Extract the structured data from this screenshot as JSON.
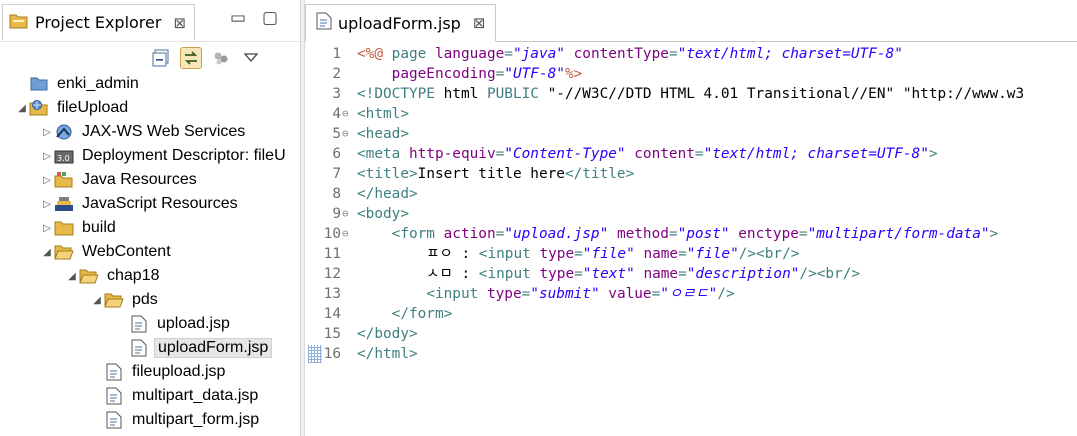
{
  "explorer": {
    "tab_label": "Project Explorer",
    "tree": [
      {
        "label": "enki_admin",
        "icon": "folder-closed-project-icon",
        "twisty": "",
        "depth": 0
      },
      {
        "label": "fileUpload",
        "icon": "web-project-icon",
        "twisty": "expanded",
        "depth": 0
      },
      {
        "label": "JAX-WS Web Services",
        "icon": "web-services-icon",
        "twisty": "collapsed",
        "depth": 1
      },
      {
        "label": "Deployment Descriptor: fileU",
        "icon": "deployment-descriptor-icon",
        "twisty": "collapsed",
        "depth": 1
      },
      {
        "label": "Java Resources",
        "icon": "java-resources-icon",
        "twisty": "collapsed",
        "depth": 1
      },
      {
        "label": "JavaScript Resources",
        "icon": "javascript-resources-icon",
        "twisty": "collapsed",
        "depth": 1
      },
      {
        "label": "build",
        "icon": "folder-icon",
        "twisty": "collapsed",
        "depth": 1
      },
      {
        "label": "WebContent",
        "icon": "folder-open-icon",
        "twisty": "expanded",
        "depth": 1
      },
      {
        "label": "chap18",
        "icon": "folder-open-icon",
        "twisty": "expanded",
        "depth": 2
      },
      {
        "label": "pds",
        "icon": "folder-open-icon",
        "twisty": "expanded",
        "depth": 3
      },
      {
        "label": "upload.jsp",
        "icon": "jsp-file-icon",
        "twisty": "",
        "depth": 4
      },
      {
        "label": "uploadForm.jsp",
        "icon": "jsp-file-icon",
        "twisty": "",
        "depth": 4,
        "selected": true
      },
      {
        "label": "fileupload.jsp",
        "icon": "jsp-file-icon",
        "twisty": "",
        "depth": 3
      },
      {
        "label": "multipart_data.jsp",
        "icon": "jsp-file-icon",
        "twisty": "",
        "depth": 3
      },
      {
        "label": "multipart_form.jsp",
        "icon": "jsp-file-icon",
        "twisty": "",
        "depth": 3
      }
    ]
  },
  "editor": {
    "tab_label": "uploadForm.jsp",
    "lines": [
      {
        "n": "1",
        "fold": "",
        "tokens": [
          [
            "jsp",
            "<%@ "
          ],
          [
            "tag",
            "page "
          ],
          [
            "attr",
            "language"
          ],
          [
            "tag",
            "="
          ],
          [
            "str",
            "\"java\""
          ],
          [
            "tag",
            " "
          ],
          [
            "attr",
            "contentType"
          ],
          [
            "tag",
            "="
          ],
          [
            "str",
            "\"text/html; charset=UTF-8\""
          ]
        ]
      },
      {
        "n": "2",
        "fold": "",
        "tokens": [
          [
            "text",
            "    "
          ],
          [
            "attr",
            "pageEncoding"
          ],
          [
            "tag",
            "="
          ],
          [
            "str",
            "\"UTF-8\""
          ],
          [
            "jsp",
            "%>"
          ]
        ]
      },
      {
        "n": "3",
        "fold": "",
        "tokens": [
          [
            "tag",
            "<!DOCTYPE "
          ],
          [
            "dt",
            "html"
          ],
          [
            "tag",
            " PUBLIC "
          ],
          [
            "dt",
            "\"-//W3C//DTD HTML 4.01 Transitional//EN\" \"http://www.w3"
          ]
        ]
      },
      {
        "n": "4",
        "fold": "⊖",
        "tokens": [
          [
            "tag",
            "<html>"
          ]
        ]
      },
      {
        "n": "5",
        "fold": "⊖",
        "tokens": [
          [
            "tag",
            "<head>"
          ]
        ]
      },
      {
        "n": "6",
        "fold": "",
        "tokens": [
          [
            "tag",
            "<meta "
          ],
          [
            "attr",
            "http-equiv"
          ],
          [
            "tag",
            "="
          ],
          [
            "str",
            "\"Content-Type\""
          ],
          [
            "tag",
            " "
          ],
          [
            "attr",
            "content"
          ],
          [
            "tag",
            "="
          ],
          [
            "str",
            "\"text/html; charset=UTF-8\""
          ],
          [
            "tag",
            ">"
          ]
        ]
      },
      {
        "n": "7",
        "fold": "",
        "tokens": [
          [
            "tag",
            "<title>"
          ],
          [
            "text",
            "Insert title here"
          ],
          [
            "tag",
            "</title>"
          ]
        ]
      },
      {
        "n": "8",
        "fold": "",
        "tokens": [
          [
            "tag",
            "</head>"
          ]
        ]
      },
      {
        "n": "9",
        "fold": "⊖",
        "tokens": [
          [
            "tag",
            "<body>"
          ]
        ]
      },
      {
        "n": "10",
        "fold": "⊖",
        "tokens": [
          [
            "text",
            "    "
          ],
          [
            "tag",
            "<form "
          ],
          [
            "attr",
            "action"
          ],
          [
            "tag",
            "="
          ],
          [
            "str",
            "\"upload.jsp\""
          ],
          [
            "tag",
            " "
          ],
          [
            "attr",
            "method"
          ],
          [
            "tag",
            "="
          ],
          [
            "str",
            "\"post\""
          ],
          [
            "tag",
            " "
          ],
          [
            "attr",
            "enctype"
          ],
          [
            "tag",
            "="
          ],
          [
            "str",
            "\"multipart/form-data\""
          ],
          [
            "tag",
            ">"
          ]
        ]
      },
      {
        "n": "11",
        "fold": "",
        "tokens": [
          [
            "text",
            "        ㅍㅇ : "
          ],
          [
            "tag",
            "<input "
          ],
          [
            "attr",
            "type"
          ],
          [
            "tag",
            "="
          ],
          [
            "str",
            "\"file\""
          ],
          [
            "tag",
            " "
          ],
          [
            "attr",
            "name"
          ],
          [
            "tag",
            "="
          ],
          [
            "str",
            "\"file\""
          ],
          [
            "tag",
            "/><br/>"
          ]
        ]
      },
      {
        "n": "12",
        "fold": "",
        "tokens": [
          [
            "text",
            "        ㅅㅁ : "
          ],
          [
            "tag",
            "<input "
          ],
          [
            "attr",
            "type"
          ],
          [
            "tag",
            "="
          ],
          [
            "str",
            "\"text\""
          ],
          [
            "tag",
            " "
          ],
          [
            "attr",
            "name"
          ],
          [
            "tag",
            "="
          ],
          [
            "str",
            "\"description\""
          ],
          [
            "tag",
            "/><br/>"
          ]
        ]
      },
      {
        "n": "13",
        "fold": "",
        "tokens": [
          [
            "text",
            "        "
          ],
          [
            "tag",
            "<input "
          ],
          [
            "attr",
            "type"
          ],
          [
            "tag",
            "="
          ],
          [
            "str",
            "\"submit\""
          ],
          [
            "tag",
            " "
          ],
          [
            "attr",
            "value"
          ],
          [
            "tag",
            "="
          ],
          [
            "str",
            "\"ㅇㄹㄷ\""
          ],
          [
            "tag",
            "/>"
          ]
        ]
      },
      {
        "n": "14",
        "fold": "",
        "tokens": [
          [
            "text",
            "    "
          ],
          [
            "tag",
            "</form>"
          ]
        ]
      },
      {
        "n": "15",
        "fold": "",
        "tokens": [
          [
            "tag",
            "</body>"
          ]
        ]
      },
      {
        "n": "16",
        "fold": "",
        "marker": true,
        "tokens": [
          [
            "tag",
            "</html>"
          ]
        ]
      }
    ]
  },
  "colors": {
    "tag": "#3f7f7f",
    "attribute": "#7f007f",
    "string": "#2a00ff",
    "jsp_delimiter": "#bf5f3f",
    "folder": "#e8b84a"
  }
}
